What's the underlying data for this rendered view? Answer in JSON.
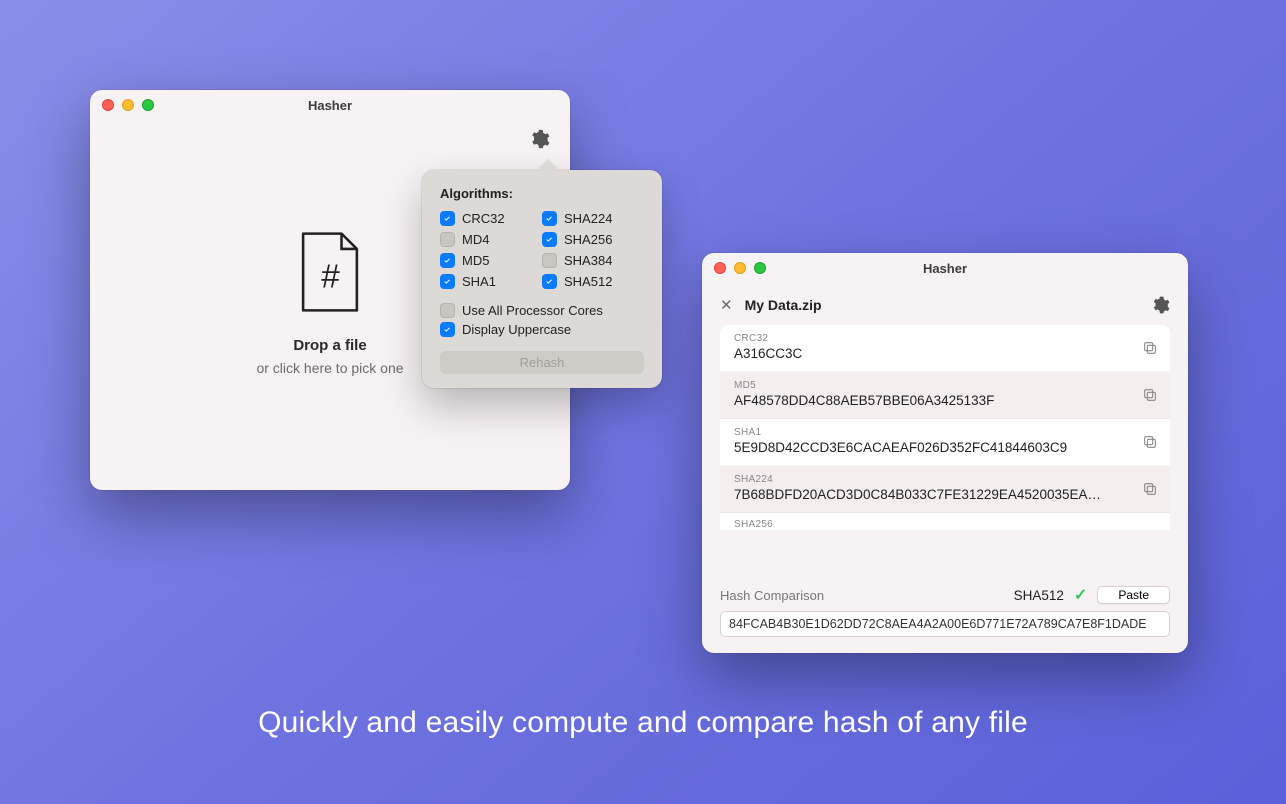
{
  "tagline": "Quickly and easily compute and compare hash of any file",
  "window1": {
    "title": "Hasher",
    "drop_title": "Drop a file",
    "drop_sub": "or click here to pick one"
  },
  "popover": {
    "heading": "Algorithms:",
    "algos": [
      {
        "name": "CRC32",
        "checked": true
      },
      {
        "name": "MD4",
        "checked": false
      },
      {
        "name": "MD5",
        "checked": true
      },
      {
        "name": "SHA1",
        "checked": true
      },
      {
        "name": "SHA224",
        "checked": true
      },
      {
        "name": "SHA256",
        "checked": true
      },
      {
        "name": "SHA384",
        "checked": false
      },
      {
        "name": "SHA512",
        "checked": true
      }
    ],
    "use_all_cores": {
      "label": "Use All Processor Cores",
      "checked": false
    },
    "uppercase": {
      "label": "Display Uppercase",
      "checked": true
    },
    "rehash_label": "Rehash"
  },
  "window2": {
    "title": "Hasher",
    "filename": "My Data.zip",
    "hashes": [
      {
        "algo": "CRC32",
        "value": "A316CC3C"
      },
      {
        "algo": "MD5",
        "value": "AF48578DD4C88AEB57BBE06A3425133F"
      },
      {
        "algo": "SHA1",
        "value": "5E9D8D42CCD3E6CACAEAF026D352FC41844603C9"
      },
      {
        "algo": "SHA224",
        "value": "7B68BDFD20ACD3D0C84B033C7FE31229EA4520035EA…"
      },
      {
        "algo": "SHA256",
        "value": ""
      }
    ],
    "compare": {
      "label": "Hash Comparison",
      "match_algo": "SHA512",
      "paste_label": "Paste",
      "value": "84FCAB4B30E1D62DD72C8AEA4A2A00E6D771E72A789CA7E8F1DADE"
    }
  }
}
